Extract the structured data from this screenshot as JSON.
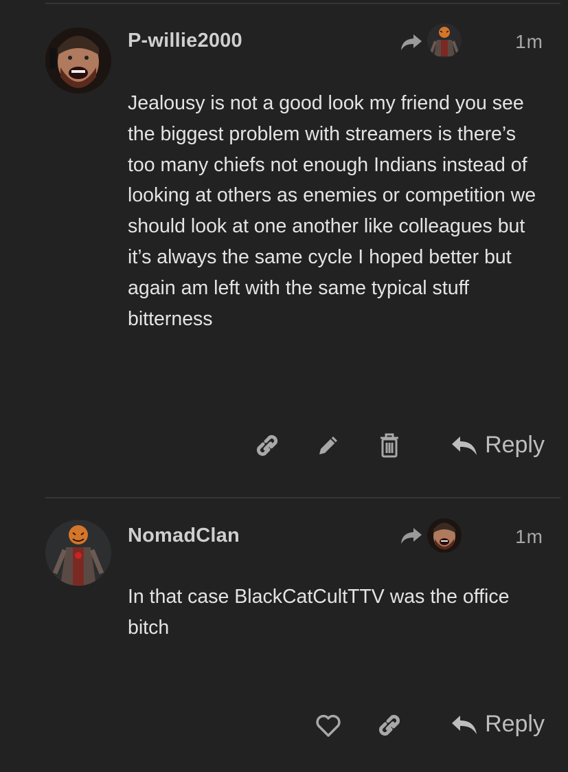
{
  "posts": [
    {
      "username": "P-willie2000",
      "time": "1m",
      "body": "Jealousy is not a good look my friend you see the biggest problem with streamers is there’s too many chiefs not enough Indians instead of looking at others as enemies or competition we should look at one another like colleagues but it’s always the same cycle I hoped better but again am left with the same typical stuff bitterness",
      "actions": [
        "link-icon",
        "edit-icon",
        "trash-icon"
      ],
      "reply_label": "Reply"
    },
    {
      "username": "NomadClan",
      "time": "1m",
      "body": "In that case BlackCatCultTTV was the office bitch",
      "actions": [
        "heart-icon",
        "link-icon"
      ],
      "reply_label": "Reply"
    }
  ],
  "colors": {
    "background": "#222222",
    "divider": "#353535",
    "text": "#e4e4e4",
    "muted": "#a8a8a8"
  }
}
